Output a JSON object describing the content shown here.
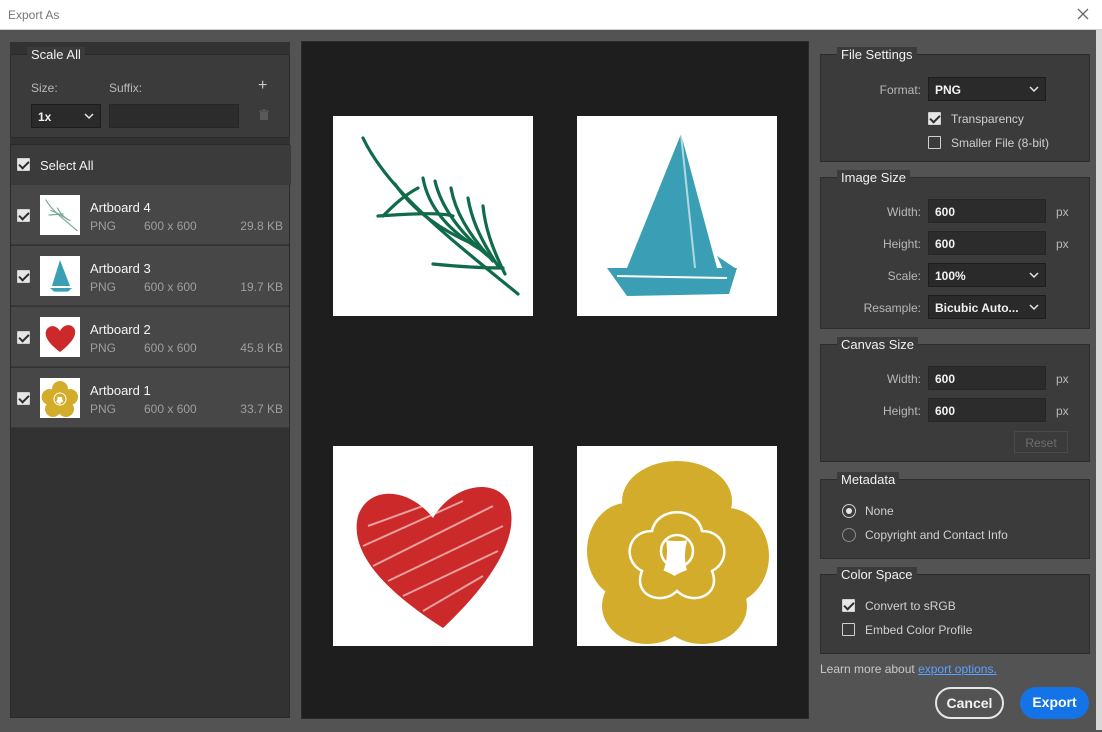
{
  "window": {
    "title": "Export As"
  },
  "scale_all": {
    "title": "Scale All",
    "size_label": "Size:",
    "suffix_label": "Suffix:",
    "size_value": "1x",
    "suffix_value": "",
    "add_icon": "plus-icon",
    "delete_icon": "trash-icon"
  },
  "select_all": {
    "label": "Select All",
    "checked": true
  },
  "artboards": [
    {
      "name": "Artboard 4",
      "format": "PNG",
      "dims": "600 x 600",
      "size": "29.8 KB",
      "checked": true,
      "thumb": "fern"
    },
    {
      "name": "Artboard 3",
      "format": "PNG",
      "dims": "600 x 600",
      "size": "19.7 KB",
      "checked": true,
      "thumb": "sailboat"
    },
    {
      "name": "Artboard 2",
      "format": "PNG",
      "dims": "600 x 600",
      "size": "45.8 KB",
      "checked": true,
      "thumb": "heart"
    },
    {
      "name": "Artboard 1",
      "format": "PNG",
      "dims": "600 x 600",
      "size": "33.7 KB",
      "checked": true,
      "thumb": "flower"
    }
  ],
  "file_settings": {
    "title": "File Settings",
    "format_label": "Format:",
    "format_value": "PNG",
    "transparency_label": "Transparency",
    "transparency_checked": true,
    "smaller_label": "Smaller File (8-bit)",
    "smaller_checked": false
  },
  "image_size": {
    "title": "Image Size",
    "width_label": "Width:",
    "width_value": "600",
    "height_label": "Height:",
    "height_value": "600",
    "unit": "px",
    "scale_label": "Scale:",
    "scale_value": "100%",
    "resample_label": "Resample:",
    "resample_value": "Bicubic Auto..."
  },
  "canvas_size": {
    "title": "Canvas Size",
    "width_label": "Width:",
    "width_value": "600",
    "height_label": "Height:",
    "height_value": "600",
    "unit": "px",
    "reset_label": "Reset"
  },
  "metadata": {
    "title": "Metadata",
    "none_label": "None",
    "copyright_label": "Copyright and Contact Info",
    "selected": "None"
  },
  "color_space": {
    "title": "Color Space",
    "srgb_label": "Convert to sRGB",
    "srgb_checked": true,
    "embed_label": "Embed Color Profile",
    "embed_checked": false
  },
  "footer": {
    "learn_text": "Learn more about",
    "learn_link": "export options.",
    "cancel_label": "Cancel",
    "export_label": "Export"
  },
  "colors": {
    "accent": "#1473e6",
    "fern": "#0f6b4a",
    "sail": "#3a9fb5",
    "heart": "#cc2a2a",
    "flower": "#d4ac2b"
  }
}
